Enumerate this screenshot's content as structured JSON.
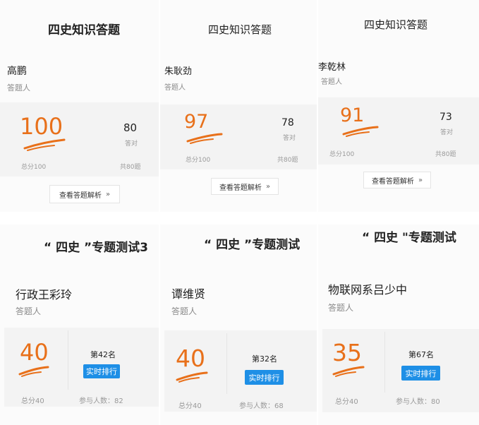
{
  "top_cards": [
    {
      "title": "四史知识答题",
      "name": "高鹏",
      "role": "答题人",
      "score": "100",
      "correct": "80",
      "correct_label": "答对",
      "total_label": "总分100",
      "count_label": "共80题",
      "analysis_button": "查看答题解析"
    },
    {
      "title": "四史知识答题",
      "name": "朱耿劲",
      "role": "答题人",
      "score": "97",
      "correct": "78",
      "correct_label": "答对",
      "total_label": "总分100",
      "count_label": "共80题",
      "analysis_button": "查看答题解析"
    },
    {
      "title": "四史知识答题",
      "name": "李乾林",
      "role": "答题人",
      "score": "91",
      "correct": "73",
      "correct_label": "答对",
      "total_label": "总分100",
      "count_label": "共80题",
      "analysis_button": "查看答题解析"
    }
  ],
  "bottom_cards": [
    {
      "title": "“ 四史 ”专题测试3",
      "name": "行政王彩玲",
      "role": "答题人",
      "score": "40",
      "rank": "第42名",
      "rank_button": "实时排行",
      "total_label": "总分40",
      "participants_label": "参与人数：82"
    },
    {
      "title": "“ 四史 ”专题测试",
      "name": "谭维贤",
      "role": "答题人",
      "score": "40",
      "rank": "第32名",
      "rank_button": "实时排行",
      "total_label": "总分40",
      "participants_label": "参与人数：68"
    },
    {
      "title": "“ 四史 \"专题测试",
      "name": "物联网系吕少中",
      "role": "答题人",
      "score": "35",
      "rank": "第67名",
      "rank_button": "实时排行",
      "total_label": "总分40",
      "participants_label": "参与人数：80"
    }
  ],
  "colors": {
    "score_orange": "#e8701a",
    "button_blue": "#1e8fe6"
  }
}
